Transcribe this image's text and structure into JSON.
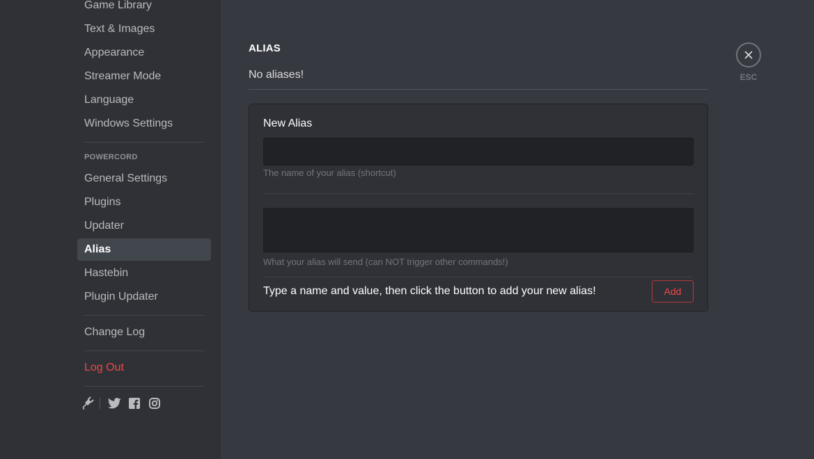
{
  "sidebar": {
    "items_top": [
      {
        "label": "Game Library"
      },
      {
        "label": "Text & Images"
      },
      {
        "label": "Appearance"
      },
      {
        "label": "Streamer Mode"
      },
      {
        "label": "Language"
      },
      {
        "label": "Windows Settings"
      }
    ],
    "powercord_header": "POWERCORD",
    "powercord_items": [
      {
        "label": "General Settings"
      },
      {
        "label": "Plugins"
      },
      {
        "label": "Updater"
      },
      {
        "label": "Alias"
      },
      {
        "label": "Hastebin"
      },
      {
        "label": "Plugin Updater"
      }
    ],
    "change_log": "Change Log",
    "log_out": "Log Out",
    "social_icons": [
      "powercord-plug-icon",
      "twitter-icon",
      "facebook-icon",
      "instagram-icon"
    ]
  },
  "main": {
    "title": "ALIAS",
    "empty_message": "No aliases!",
    "new_alias": {
      "title": "New Alias",
      "name_value": "",
      "name_hint": "The name of your alias (shortcut)",
      "value_value": "",
      "value_hint": "What your alias will send (can NOT trigger other commands!)",
      "footer_text": "Type a name and value, then click the button to add your new alias!",
      "add_label": "Add"
    }
  },
  "close": {
    "label": "ESC"
  },
  "colors": {
    "background": "#36393f",
    "sidebar": "#2f3136",
    "danger": "#f04747",
    "active_item": "#42464d"
  }
}
